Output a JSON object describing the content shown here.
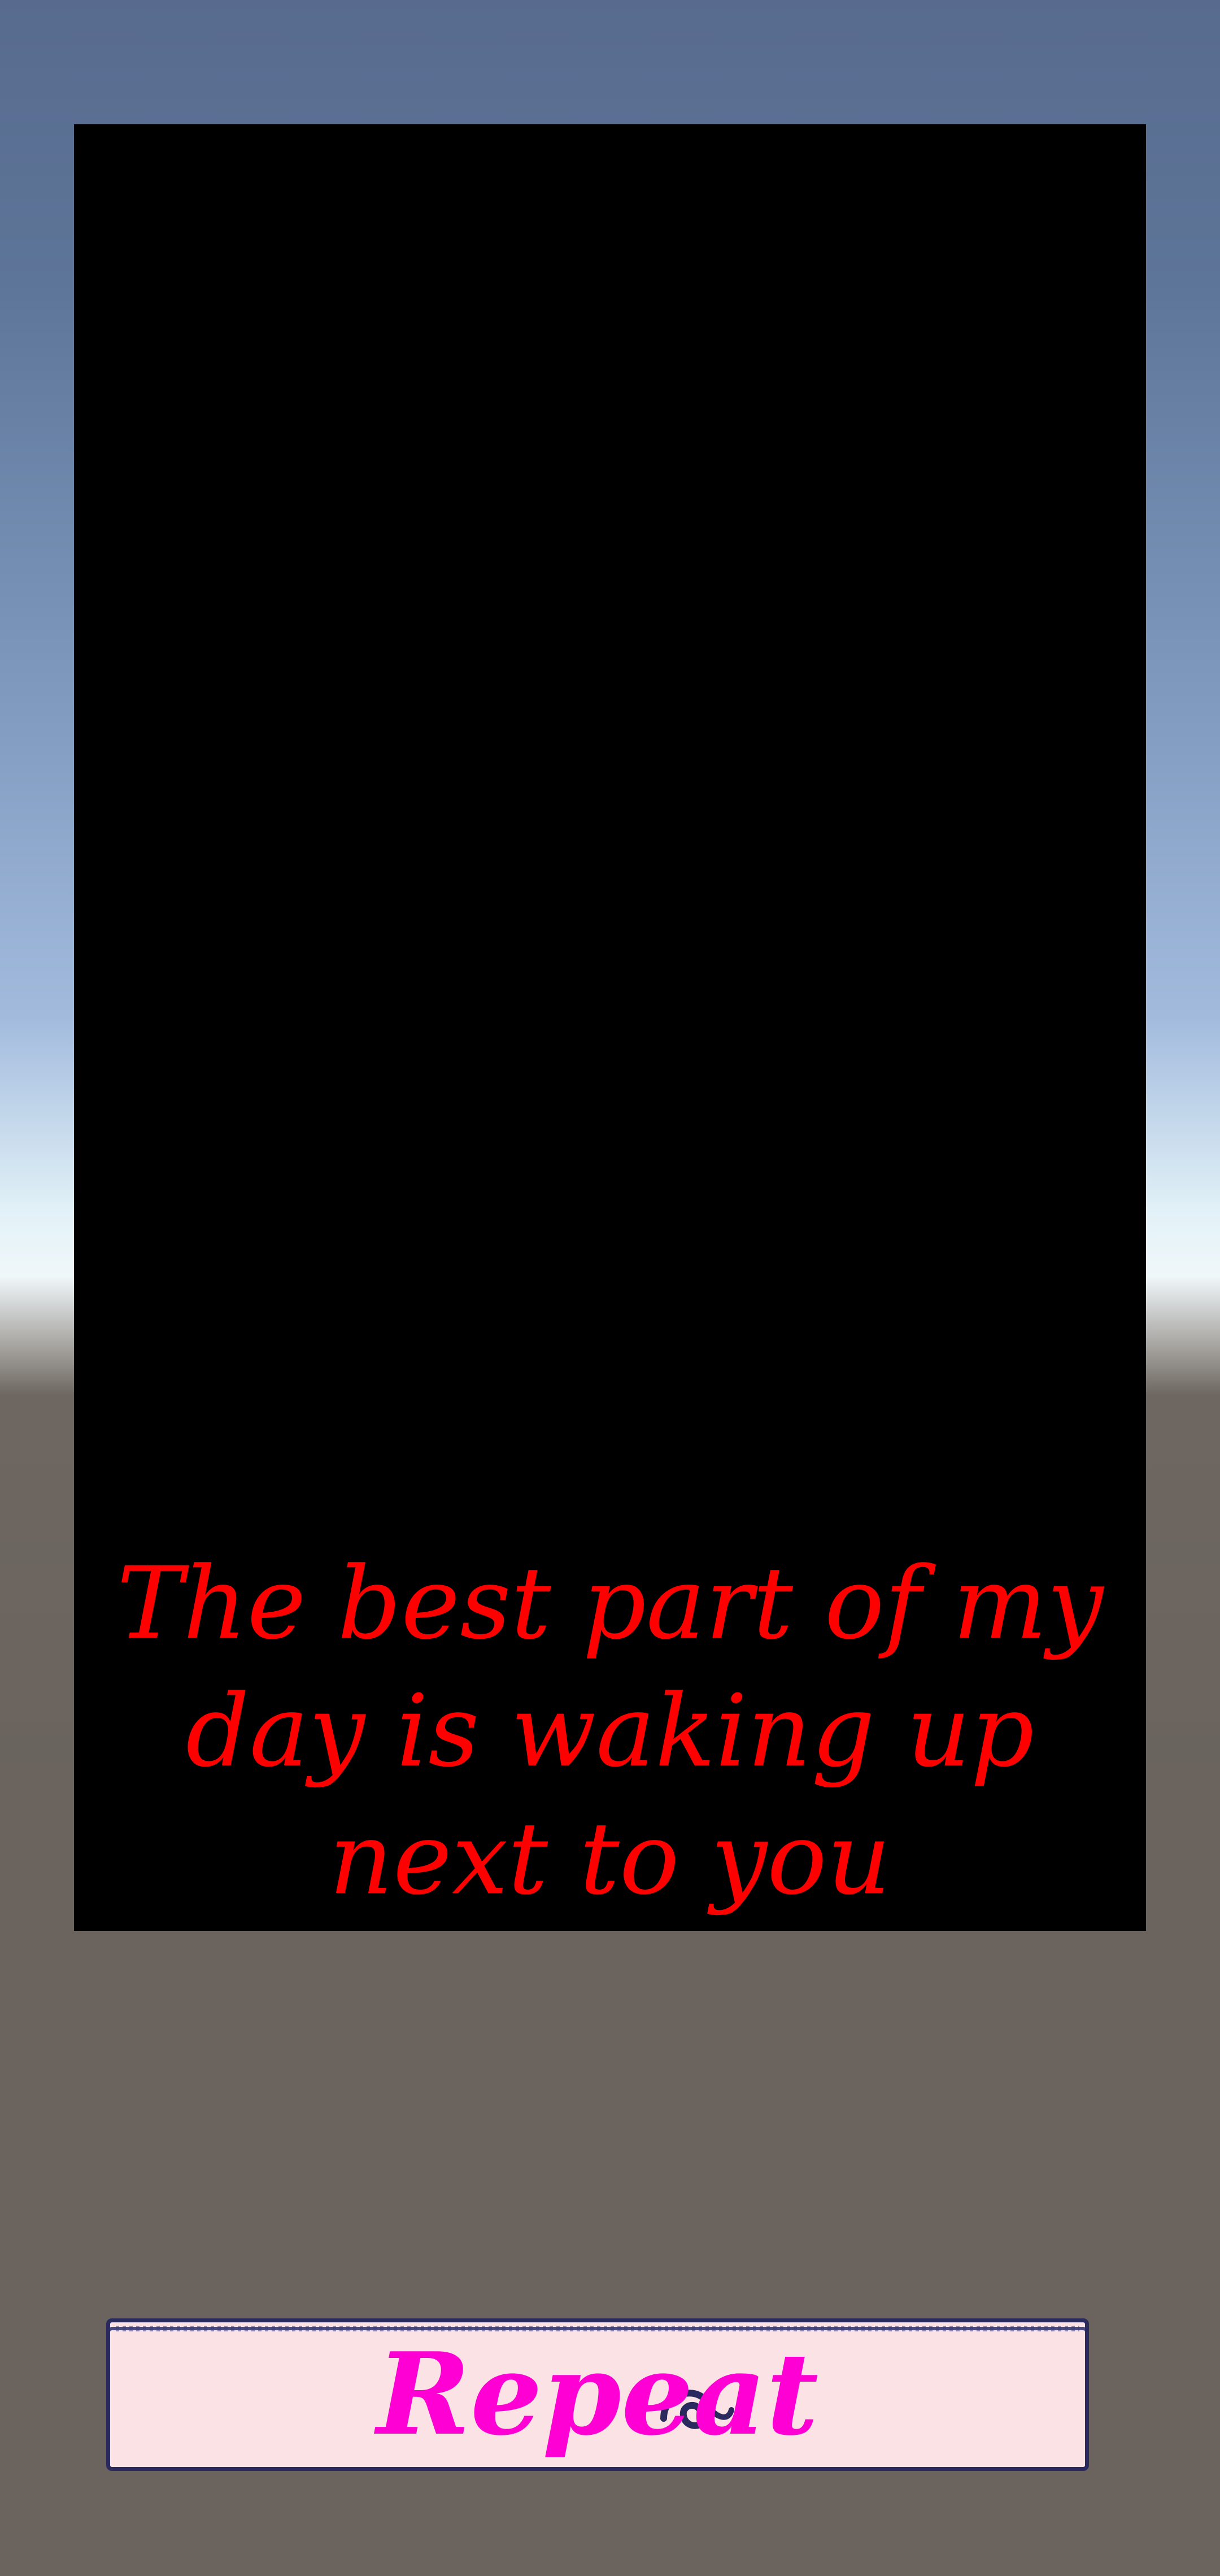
{
  "caption": {
    "text": "The best part of my day is waking up next to you",
    "color": "#ff0000"
  },
  "repeat_button": {
    "label": "Repeat",
    "label_color": "#ff00d4",
    "background": "#fbe3e5",
    "icon": "swirl-ornament-icon"
  },
  "colors": {
    "sky_top": "#586b8f",
    "horizon": "#f0f7f9",
    "ground": "#6a635e",
    "panel": "#000000"
  }
}
